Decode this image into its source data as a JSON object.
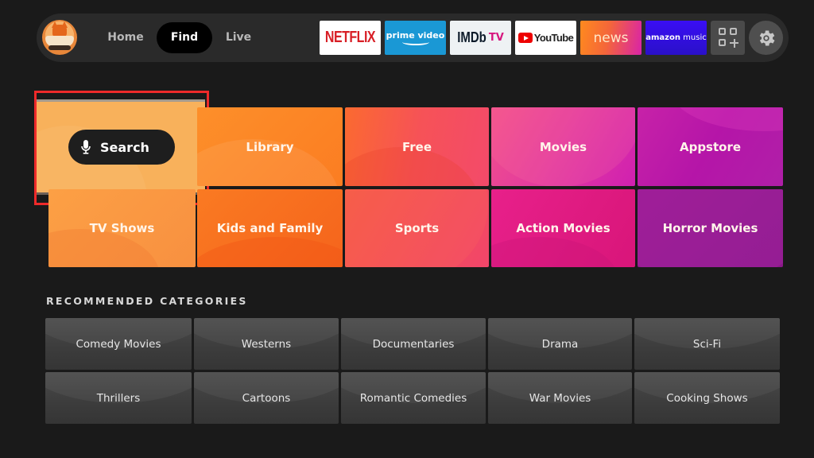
{
  "topbar": {
    "profile_icon": "fox-profile-avatar",
    "tabs": [
      {
        "label": "Home",
        "active": false
      },
      {
        "label": "Find",
        "active": true
      },
      {
        "label": "Live",
        "active": false
      }
    ],
    "apps": [
      {
        "name": "netflix",
        "label": "NETFLIX"
      },
      {
        "name": "prime-video",
        "label": "prime video"
      },
      {
        "name": "imdb-tv",
        "label_imdb": "IMDb",
        "label_tv": "TV"
      },
      {
        "name": "youtube",
        "label": "YouTube"
      },
      {
        "name": "news",
        "label": "news"
      },
      {
        "name": "amazon-music",
        "label_brand": "amazon",
        "label_service": "music"
      }
    ],
    "apps_button_icon": "apps-grid-plus-icon",
    "settings_icon": "gear-icon"
  },
  "categories": {
    "search": {
      "label": "Search",
      "icon": "microphone-icon",
      "focused": true
    },
    "row1": [
      "Library",
      "Free",
      "Movies",
      "Appstore"
    ],
    "row2": [
      "TV Shows",
      "Kids and Family",
      "Sports",
      "Action Movies",
      "Horror Movies"
    ]
  },
  "recommended": {
    "heading": "RECOMMENDED CATEGORIES",
    "row1": [
      "Comedy Movies",
      "Westerns",
      "Documentaries",
      "Drama",
      "Sci-Fi"
    ],
    "row2": [
      "Thrillers",
      "Cartoons",
      "Romantic Comedies",
      "War Movies",
      "Cooking Shows"
    ]
  },
  "colors": {
    "background": "#1a1a1a",
    "focus_ring": "#ee2a2a",
    "active_tab": "#000000"
  }
}
